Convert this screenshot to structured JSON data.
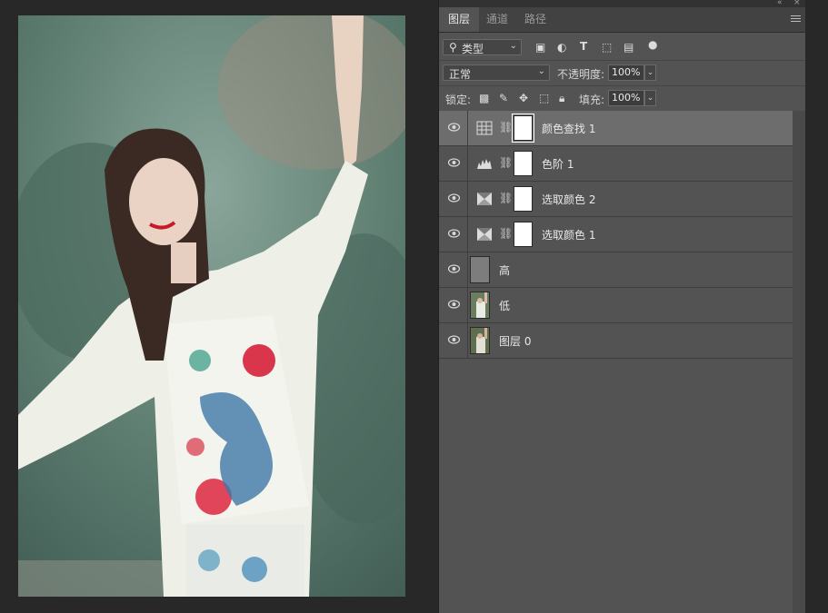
{
  "panel": {
    "tabs": [
      {
        "label": "图层",
        "active": true
      },
      {
        "label": "通道",
        "active": false
      },
      {
        "label": "路径",
        "active": false
      }
    ],
    "filter": {
      "icon": "search-icon",
      "label": "类型"
    },
    "blend_mode": "正常",
    "opacity_label": "不透明度:",
    "opacity_value": "100%",
    "lock_label": "锁定:",
    "fill_label": "填充:",
    "fill_value": "100%",
    "layers": [
      {
        "name": "颜色查找 1",
        "type": "color-lookup-adjustment",
        "selected": true
      },
      {
        "name": "色阶 1",
        "type": "levels-adjustment"
      },
      {
        "name": "选取颜色 2",
        "type": "selective-color-adjustment"
      },
      {
        "name": "选取颜色 1",
        "type": "selective-color-adjustment"
      },
      {
        "name": "高",
        "type": "pixel-layer-gray"
      },
      {
        "name": "低",
        "type": "pixel-layer-photo"
      },
      {
        "name": "图层 0",
        "type": "pixel-layer-photo"
      }
    ]
  },
  "colors": {
    "panel_bg": "#535353",
    "selected_layer": "#6d6d6d",
    "workspace": "#282828"
  }
}
